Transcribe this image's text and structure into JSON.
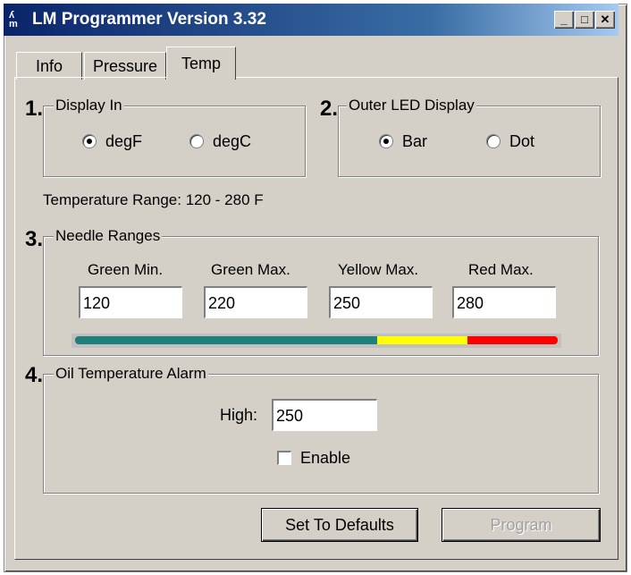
{
  "window": {
    "title": "LM Programmer Version 3.32",
    "app_icon_text": "ʎ\nm",
    "controls": {
      "minimize": "_",
      "maximize": "□",
      "close": "✕"
    }
  },
  "tabs": [
    {
      "label": "Info",
      "active": false
    },
    {
      "label": "Pressure",
      "active": false
    },
    {
      "label": "Temp",
      "active": true
    }
  ],
  "sections": {
    "display_in": {
      "number": "1.",
      "label": "Display In",
      "options": [
        {
          "label": "degF",
          "selected": true
        },
        {
          "label": "degC",
          "selected": false
        }
      ]
    },
    "outer_led": {
      "number": "2.",
      "label": "Outer LED Display",
      "options": [
        {
          "label": "Bar",
          "selected": true
        },
        {
          "label": "Dot",
          "selected": false
        }
      ]
    },
    "temperature_range": "Temperature Range: 120 - 280 F",
    "needle_ranges": {
      "number": "3.",
      "label": "Needle Ranges",
      "fields": [
        {
          "label": "Green Min.",
          "value": "120"
        },
        {
          "label": "Green Max.",
          "value": "220"
        },
        {
          "label": "Yellow Max.",
          "value": "250"
        },
        {
          "label": "Red Max.",
          "value": "280"
        }
      ],
      "bar_colors": {
        "green": "#1f7f7a",
        "yellow": "#ffff00",
        "red": "#ff0000"
      },
      "range_min": 120,
      "green_max": 220,
      "yellow_max": 250,
      "red_max": 280
    },
    "oil_alarm": {
      "number": "4.",
      "label": "Oil Temperature Alarm",
      "high_label": "High:",
      "high_value": "250",
      "enable_label": "Enable",
      "enable_checked": false
    }
  },
  "buttons": {
    "defaults": "Set To Defaults",
    "program": "Program"
  }
}
